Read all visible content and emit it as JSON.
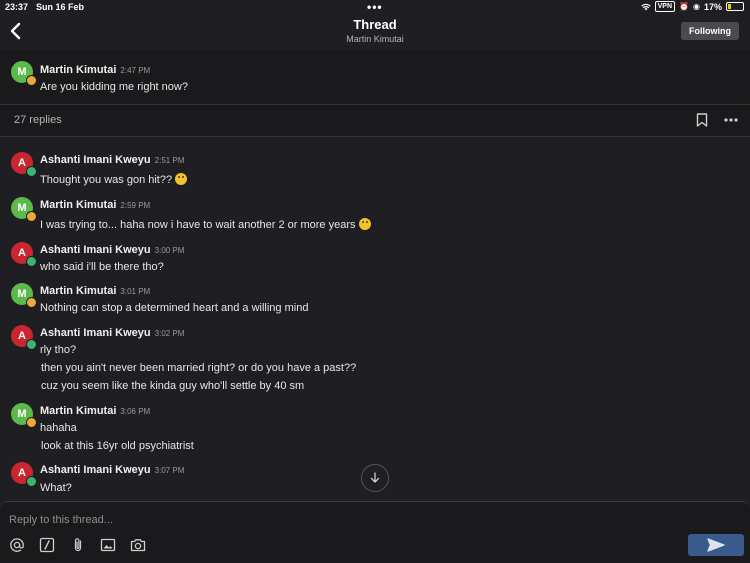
{
  "status_bar": {
    "time": "23:37",
    "date": "Sun 16 Feb",
    "vpn": "VPN",
    "battery": "17%"
  },
  "header": {
    "title": "Thread",
    "subtitle": "Martin Kimutai",
    "follow_label": "Following"
  },
  "original_post": {
    "avatar_letter": "M",
    "author": "Martin Kimutai",
    "time": "2:47 PM",
    "text": "Are you kidding me right now?"
  },
  "replies_label": "27 replies",
  "messages": [
    {
      "avatar_letter": "A",
      "author": "Ashanti Imani Kweyu",
      "time": "2:51 PM",
      "lines": [
        "Thought you was gon hit??"
      ]
    },
    {
      "avatar_letter": "M",
      "author": "Martin Kimutai",
      "time": "2:59 PM",
      "lines": [
        "I was trying to... haha now i have to wait another 2 or more years"
      ]
    },
    {
      "avatar_letter": "A",
      "author": "Ashanti Imani Kweyu",
      "time": "3:00 PM",
      "lines": [
        "who said i'll be there tho?"
      ]
    },
    {
      "avatar_letter": "M",
      "author": "Martin Kimutai",
      "time": "3:01 PM",
      "lines": [
        "Nothing can stop a determined heart and a willing mind"
      ]
    },
    {
      "avatar_letter": "A",
      "author": "Ashanti Imani Kweyu",
      "time": "3:02 PM",
      "lines": [
        "rly tho?",
        "then you ain't never been married right? or do you have a past??",
        "cuz you seem like the kinda guy who'll settle by 40 sm"
      ]
    },
    {
      "avatar_letter": "M",
      "author": "Martin Kimutai",
      "time": "3:06 PM",
      "lines": [
        "hahaha",
        "look at this 16yr old psychiatrist"
      ]
    },
    {
      "avatar_letter": "A",
      "author": "Ashanti Imani Kweyu",
      "time": "3:07 PM",
      "lines": [
        "What?"
      ]
    }
  ],
  "composer": {
    "placeholder": "Reply to this thread..."
  },
  "colors": {
    "background": "#1f1f23",
    "accent_send": "#3a5a8c",
    "avatar_green": "#5cba4c",
    "avatar_red": "#c9262f"
  }
}
